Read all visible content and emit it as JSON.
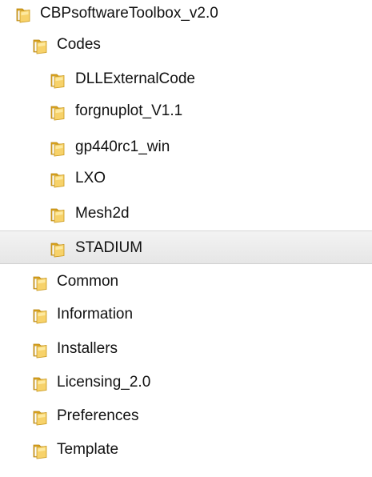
{
  "folder_tree": {
    "items": [
      {
        "label": "CBPsoftwareToolbox_v2.0",
        "depth": 0,
        "icon": "folder-icon",
        "selected": false
      },
      {
        "label": "Codes",
        "depth": 1,
        "icon": "folder-icon",
        "selected": false
      },
      {
        "label": "DLLExternalCode",
        "depth": 2,
        "icon": "folder-icon",
        "selected": false
      },
      {
        "label": "forgnuplot_V1.1",
        "depth": 2,
        "icon": "folder-icon",
        "selected": false
      },
      {
        "label": "gp440rc1_win",
        "depth": 2,
        "icon": "folder-icon",
        "selected": false
      },
      {
        "label": "LXO",
        "depth": 2,
        "icon": "folder-icon",
        "selected": false
      },
      {
        "label": "Mesh2d",
        "depth": 2,
        "icon": "folder-icon",
        "selected": false
      },
      {
        "label": "STADIUM",
        "depth": 2,
        "icon": "folder-icon",
        "selected": true
      },
      {
        "label": "Common",
        "depth": 1,
        "icon": "folder-icon",
        "selected": false
      },
      {
        "label": "Information",
        "depth": 1,
        "icon": "folder-icon",
        "selected": false
      },
      {
        "label": "Installers",
        "depth": 1,
        "icon": "folder-icon",
        "selected": false
      },
      {
        "label": "Licensing_2.0",
        "depth": 1,
        "icon": "folder-icon",
        "selected": false
      },
      {
        "label": "Preferences",
        "depth": 1,
        "icon": "folder-icon",
        "selected": false
      },
      {
        "label": "Template",
        "depth": 1,
        "icon": "folder-icon",
        "selected": false
      }
    ]
  },
  "colors": {
    "folder_back": "#d9a21b",
    "folder_front": "#f7d26a",
    "folder_highlight": "#fff2b8",
    "selection": "#ebebeb",
    "text": "#111111"
  }
}
